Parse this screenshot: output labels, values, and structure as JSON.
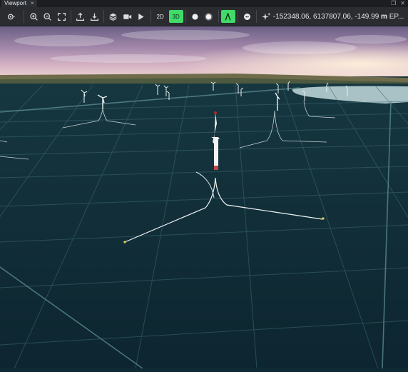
{
  "tab": {
    "title": "Viewport",
    "close": "×"
  },
  "window": {
    "restore": "❐",
    "close": "✕"
  },
  "toolbar": {
    "mode_2d": "2D",
    "mode_3d": "3D",
    "coords": "-152348.06, 6137807.06, -149.99",
    "unit": "m",
    "crs": "EP..."
  },
  "icons": {
    "settings": "gear-icon",
    "zoom_in": "zoom-in-icon",
    "zoom_out": "zoom-out-icon",
    "fit": "fit-view-icon",
    "upload": "upload-icon",
    "download": "download-icon",
    "layers": "layers-icon",
    "camera": "camera-icon",
    "play": "play-icon",
    "sphere_light": "light-sphere-icon",
    "sphere_glow": "glow-sphere-icon",
    "compass": "compass-icon",
    "record": "record-icon",
    "sparkle": "sparkle-icon"
  },
  "colors": {
    "accent": "#3fdc6a",
    "sea": "#0f2a33",
    "grid": "#3d6a74"
  }
}
